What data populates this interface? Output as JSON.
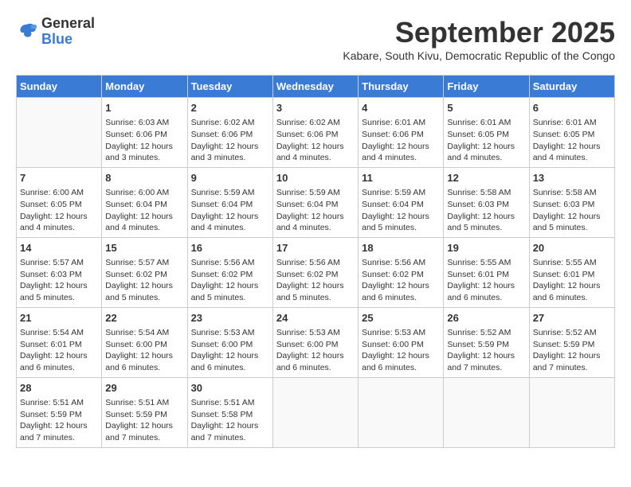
{
  "logo": {
    "general": "General",
    "blue": "Blue"
  },
  "title": "September 2025",
  "subtitle": "Kabare, South Kivu, Democratic Republic of the Congo",
  "weekdays": [
    "Sunday",
    "Monday",
    "Tuesday",
    "Wednesday",
    "Thursday",
    "Friday",
    "Saturday"
  ],
  "weeks": [
    [
      {
        "day": "",
        "info": ""
      },
      {
        "day": "1",
        "info": "Sunrise: 6:03 AM\nSunset: 6:06 PM\nDaylight: 12 hours\nand 3 minutes."
      },
      {
        "day": "2",
        "info": "Sunrise: 6:02 AM\nSunset: 6:06 PM\nDaylight: 12 hours\nand 3 minutes."
      },
      {
        "day": "3",
        "info": "Sunrise: 6:02 AM\nSunset: 6:06 PM\nDaylight: 12 hours\nand 4 minutes."
      },
      {
        "day": "4",
        "info": "Sunrise: 6:01 AM\nSunset: 6:06 PM\nDaylight: 12 hours\nand 4 minutes."
      },
      {
        "day": "5",
        "info": "Sunrise: 6:01 AM\nSunset: 6:05 PM\nDaylight: 12 hours\nand 4 minutes."
      },
      {
        "day": "6",
        "info": "Sunrise: 6:01 AM\nSunset: 6:05 PM\nDaylight: 12 hours\nand 4 minutes."
      }
    ],
    [
      {
        "day": "7",
        "info": "Sunrise: 6:00 AM\nSunset: 6:05 PM\nDaylight: 12 hours\nand 4 minutes."
      },
      {
        "day": "8",
        "info": "Sunrise: 6:00 AM\nSunset: 6:04 PM\nDaylight: 12 hours\nand 4 minutes."
      },
      {
        "day": "9",
        "info": "Sunrise: 5:59 AM\nSunset: 6:04 PM\nDaylight: 12 hours\nand 4 minutes."
      },
      {
        "day": "10",
        "info": "Sunrise: 5:59 AM\nSunset: 6:04 PM\nDaylight: 12 hours\nand 4 minutes."
      },
      {
        "day": "11",
        "info": "Sunrise: 5:59 AM\nSunset: 6:04 PM\nDaylight: 12 hours\nand 5 minutes."
      },
      {
        "day": "12",
        "info": "Sunrise: 5:58 AM\nSunset: 6:03 PM\nDaylight: 12 hours\nand 5 minutes."
      },
      {
        "day": "13",
        "info": "Sunrise: 5:58 AM\nSunset: 6:03 PM\nDaylight: 12 hours\nand 5 minutes."
      }
    ],
    [
      {
        "day": "14",
        "info": "Sunrise: 5:57 AM\nSunset: 6:03 PM\nDaylight: 12 hours\nand 5 minutes."
      },
      {
        "day": "15",
        "info": "Sunrise: 5:57 AM\nSunset: 6:02 PM\nDaylight: 12 hours\nand 5 minutes."
      },
      {
        "day": "16",
        "info": "Sunrise: 5:56 AM\nSunset: 6:02 PM\nDaylight: 12 hours\nand 5 minutes."
      },
      {
        "day": "17",
        "info": "Sunrise: 5:56 AM\nSunset: 6:02 PM\nDaylight: 12 hours\nand 5 minutes."
      },
      {
        "day": "18",
        "info": "Sunrise: 5:56 AM\nSunset: 6:02 PM\nDaylight: 12 hours\nand 6 minutes."
      },
      {
        "day": "19",
        "info": "Sunrise: 5:55 AM\nSunset: 6:01 PM\nDaylight: 12 hours\nand 6 minutes."
      },
      {
        "day": "20",
        "info": "Sunrise: 5:55 AM\nSunset: 6:01 PM\nDaylight: 12 hours\nand 6 minutes."
      }
    ],
    [
      {
        "day": "21",
        "info": "Sunrise: 5:54 AM\nSunset: 6:01 PM\nDaylight: 12 hours\nand 6 minutes."
      },
      {
        "day": "22",
        "info": "Sunrise: 5:54 AM\nSunset: 6:00 PM\nDaylight: 12 hours\nand 6 minutes."
      },
      {
        "day": "23",
        "info": "Sunrise: 5:53 AM\nSunset: 6:00 PM\nDaylight: 12 hours\nand 6 minutes."
      },
      {
        "day": "24",
        "info": "Sunrise: 5:53 AM\nSunset: 6:00 PM\nDaylight: 12 hours\nand 6 minutes."
      },
      {
        "day": "25",
        "info": "Sunrise: 5:53 AM\nSunset: 6:00 PM\nDaylight: 12 hours\nand 6 minutes."
      },
      {
        "day": "26",
        "info": "Sunrise: 5:52 AM\nSunset: 5:59 PM\nDaylight: 12 hours\nand 7 minutes."
      },
      {
        "day": "27",
        "info": "Sunrise: 5:52 AM\nSunset: 5:59 PM\nDaylight: 12 hours\nand 7 minutes."
      }
    ],
    [
      {
        "day": "28",
        "info": "Sunrise: 5:51 AM\nSunset: 5:59 PM\nDaylight: 12 hours\nand 7 minutes."
      },
      {
        "day": "29",
        "info": "Sunrise: 5:51 AM\nSunset: 5:59 PM\nDaylight: 12 hours\nand 7 minutes."
      },
      {
        "day": "30",
        "info": "Sunrise: 5:51 AM\nSunset: 5:58 PM\nDaylight: 12 hours\nand 7 minutes."
      },
      {
        "day": "",
        "info": ""
      },
      {
        "day": "",
        "info": ""
      },
      {
        "day": "",
        "info": ""
      },
      {
        "day": "",
        "info": ""
      }
    ]
  ]
}
